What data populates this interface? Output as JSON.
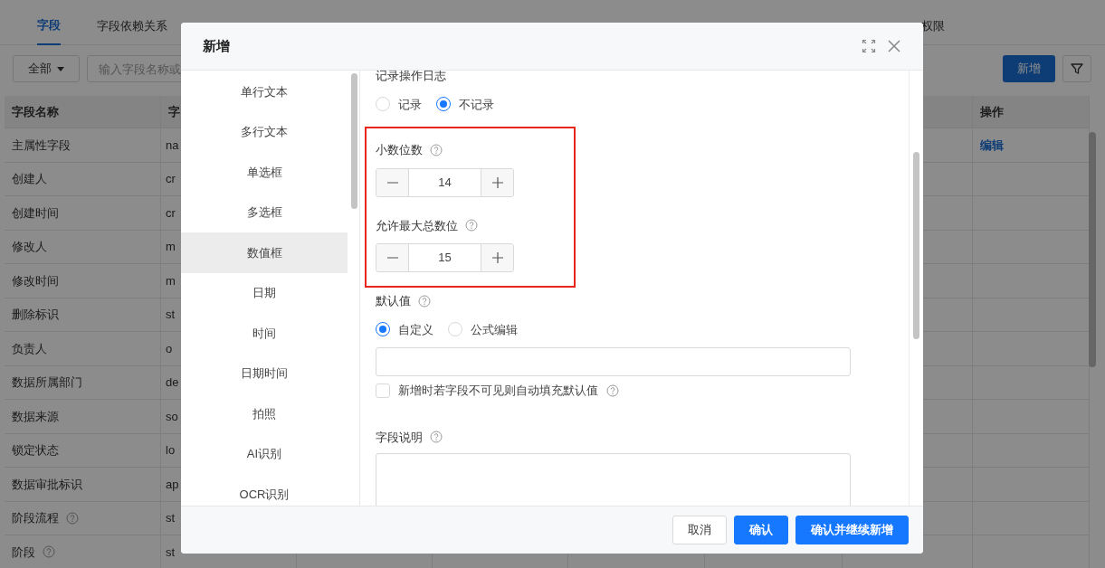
{
  "page_tabs": [
    {
      "label": "字段",
      "selected": true
    },
    {
      "label": "字段依赖关系",
      "selected": false
    },
    {
      "label": "权限",
      "selected": false
    }
  ],
  "toolbar": {
    "scope": "全部",
    "search_placeholder": "输入字段名称或",
    "add_button": "新增"
  },
  "table": {
    "columns": [
      "字段名称",
      "字",
      "操作"
    ],
    "rows": [
      {
        "name": "主属性字段",
        "code": "na",
        "action": "编辑",
        "help": false
      },
      {
        "name": "创建人",
        "code": "cr",
        "help": false
      },
      {
        "name": "创建时间",
        "code": "cr",
        "help": false
      },
      {
        "name": "修改人",
        "code": "m",
        "help": false
      },
      {
        "name": "修改时间",
        "code": "m",
        "help": false
      },
      {
        "name": "删除标识",
        "code": "st",
        "help": false
      },
      {
        "name": "负责人",
        "code": "o",
        "help": false
      },
      {
        "name": "数据所属部门",
        "code": "de",
        "help": false
      },
      {
        "name": "数据来源",
        "code": "so",
        "help": false
      },
      {
        "name": "锁定状态",
        "code": "lo",
        "help": false
      },
      {
        "name": "数据审批标识",
        "code": "ap",
        "help": false
      },
      {
        "name": "阶段流程",
        "code": "st",
        "help": true
      },
      {
        "name": "阶段",
        "code": "st",
        "help": true
      }
    ]
  },
  "modal": {
    "title": "新增",
    "field_types": [
      {
        "label": "单行文本",
        "selected": false
      },
      {
        "label": "多行文本",
        "selected": false
      },
      {
        "label": "单选框",
        "selected": false
      },
      {
        "label": "多选框",
        "selected": false
      },
      {
        "label": "数值框",
        "selected": true
      },
      {
        "label": "日期",
        "selected": false
      },
      {
        "label": "时间",
        "selected": false
      },
      {
        "label": "日期时间",
        "selected": false
      },
      {
        "label": "拍照",
        "selected": false
      },
      {
        "label": "AI识别",
        "selected": false
      },
      {
        "label": "OCR识别",
        "selected": false
      }
    ],
    "log": {
      "label": "记录操作日志",
      "options": [
        {
          "label": "记录",
          "selected": false
        },
        {
          "label": "不记录",
          "selected": true
        }
      ]
    },
    "decimal_places": {
      "label": "小数位数",
      "value": "14"
    },
    "max_digits": {
      "label": "允许最大总数位",
      "value": "15"
    },
    "default_value": {
      "label": "默认值",
      "options": [
        {
          "label": "自定义",
          "selected": true
        },
        {
          "label": "公式编辑",
          "selected": false
        }
      ],
      "autofill": {
        "label": "新增时若字段不可见则自动填充默认值",
        "checked": false
      }
    },
    "description": {
      "label": "字段说明"
    },
    "buttons": [
      {
        "label": "取消",
        "kind": "secondary"
      },
      {
        "label": "确认",
        "kind": "primary"
      },
      {
        "label": "确认并继续新增",
        "kind": "primary"
      }
    ]
  }
}
